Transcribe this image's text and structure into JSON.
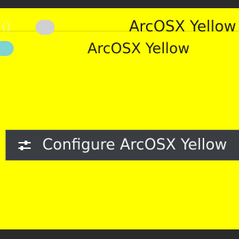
{
  "window": {
    "title": "ArcOSX Yellow",
    "header_title": "ArcOSX Yellow",
    "tooltip_text": "Configure ArcOSX Yellow"
  },
  "icons": {
    "titlebar_arrows": "arrows-icon",
    "titlebar_dot": "dot-icon",
    "header_dot": "dot-icon",
    "configure": "sliders-icon"
  },
  "colors": {
    "yellow": "#ffff00",
    "tooltip_bg": "#3a3d42",
    "tooltip_text": "#eef0f2",
    "gray_dot": "#d0d0d0",
    "teal_dot": "#7fd3d0"
  }
}
